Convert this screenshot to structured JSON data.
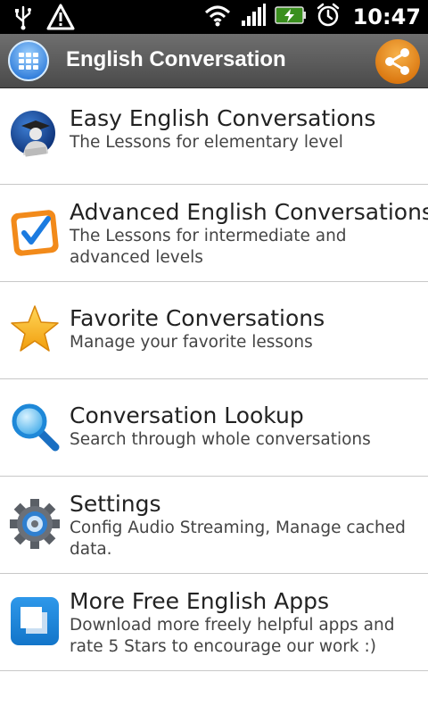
{
  "status_bar": {
    "time": "10:47",
    "icons": [
      "usb-icon",
      "warning-icon",
      "wifi-icon",
      "signal-icon",
      "battery-charging-icon",
      "alarm-icon"
    ]
  },
  "action_bar": {
    "title": "English Conversation",
    "app_icon": "grid-icon",
    "share_icon": "share-icon",
    "accent_color": "#e8891a"
  },
  "menu": {
    "items": [
      {
        "title": "Easy English Conversations",
        "subtitle": "The Lessons for elementary level",
        "icon": "student-icon"
      },
      {
        "title": "Advanced English Conversations",
        "subtitle": "The Lessons for intermediate and advanced levels",
        "icon": "checkbox-icon"
      },
      {
        "title": "Favorite Conversations",
        "subtitle": "Manage your favorite lessons",
        "icon": "star-icon"
      },
      {
        "title": "Conversation Lookup",
        "subtitle": "Search through whole conversations",
        "icon": "search-icon"
      },
      {
        "title": "Settings",
        "subtitle": "Config Audio Streaming, Manage cached data.",
        "icon": "gear-icon"
      },
      {
        "title": "More Free English Apps",
        "subtitle": "Download more freely helpful apps and rate 5 Stars to encourage our work :)",
        "icon": "app-squares-icon"
      }
    ]
  }
}
